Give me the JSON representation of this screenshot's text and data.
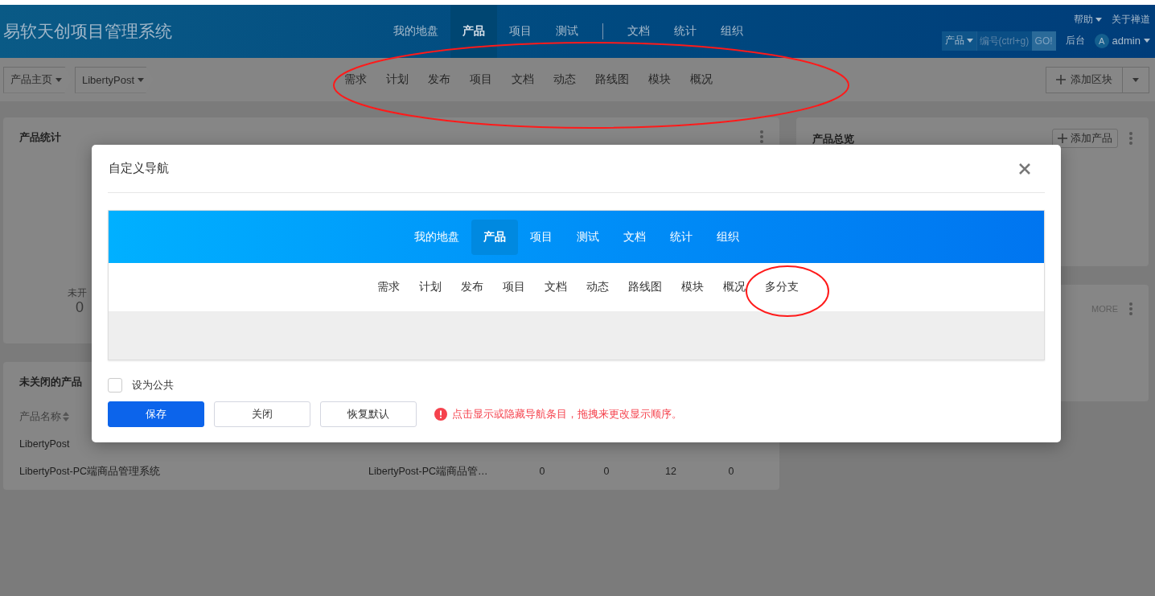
{
  "app": {
    "title": "易软天创项目管理系统"
  },
  "main_nav": [
    [
      {
        "label": "我的地盘",
        "selected": false
      },
      {
        "label": "产品",
        "selected": true
      },
      {
        "label": "项目",
        "selected": false
      },
      {
        "label": "测试",
        "selected": false
      }
    ],
    [
      {
        "label": "文档",
        "selected": false
      },
      {
        "label": "统计",
        "selected": false
      },
      {
        "label": "组织",
        "selected": false
      }
    ]
  ],
  "top_links": [
    {
      "label": "帮助",
      "dropdown": true
    },
    {
      "label": "关于禅道",
      "dropdown": false
    }
  ],
  "search": {
    "scope": "产品",
    "placeholder": "编号(ctrl+g)",
    "button": "GO!"
  },
  "admin_link": "后台",
  "user": {
    "avatar": "A",
    "name": "admin"
  },
  "breadcrumb": [
    "产品主页",
    "LibertyPost"
  ],
  "sub_nav": [
    "需求",
    "计划",
    "发布",
    "项目",
    "文档",
    "动态",
    "路线图",
    "模块",
    "概况"
  ],
  "add_block_button": "添加区块",
  "product_stats": {
    "title": "产品统计",
    "chart_label": "未开",
    "chart_value": "0"
  },
  "unclosed_products": {
    "title": "未关闭的产品",
    "columns": [
      "产品名称"
    ],
    "rows": [
      [
        "LibertyPost"
      ],
      [
        "LibertyPost-PC端商品管理系统",
        "LibertyPost-PC端商品管…",
        "0",
        "0",
        "12",
        "0"
      ]
    ]
  },
  "overview": {
    "title": "产品总览",
    "button": "添加产品"
  },
  "side_card": {
    "more": "MORE"
  },
  "dialog": {
    "title": "自定义导航",
    "preview": {
      "main_nav": [
        {
          "label": "我的地盘",
          "selected": false
        },
        {
          "label": "产品",
          "selected": true
        },
        {
          "label": "项目",
          "selected": false
        },
        {
          "label": "测试",
          "selected": false
        },
        {
          "label": "文档",
          "selected": false
        },
        {
          "label": "统计",
          "selected": false
        },
        {
          "label": "组织",
          "selected": false
        }
      ],
      "sub_nav": [
        "需求",
        "计划",
        "发布",
        "项目",
        "文档",
        "动态",
        "路线图",
        "模块",
        "概况",
        "多分支"
      ]
    },
    "public_checkbox": {
      "label": "设为公共",
      "checked": false
    },
    "buttons": [
      {
        "label": "保存",
        "kind": "primary"
      },
      {
        "label": "关闭",
        "kind": "default"
      },
      {
        "label": "恢复默认",
        "kind": "default"
      }
    ],
    "hint": "点击显示或隐藏导航条目，拖拽来更改显示顺序。"
  }
}
